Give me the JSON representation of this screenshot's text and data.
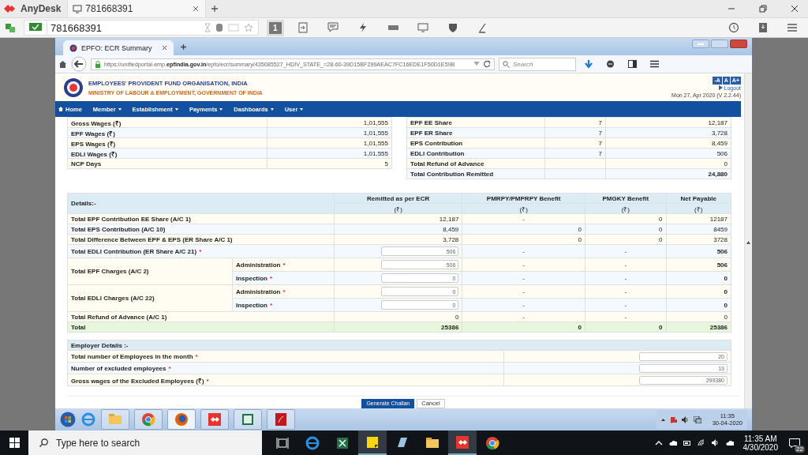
{
  "anydesk": {
    "app_name": "AnyDesk",
    "tab": "781668391",
    "address": "781668391",
    "display_number": "1"
  },
  "browser": {
    "tab_title": "EPFO: ECR Summary",
    "url_prefix": "https://unifiedportal-emp.",
    "url_domain": "epfindia.gov.in",
    "url_rest": "/epfo/ecr/summary/435085527_HDIV_STATE_=28-60-39D15BF299AEAC7FC16EDE1F50D1E59B",
    "search_placeholder": "Search"
  },
  "header": {
    "org": "EMPLOYEES' PROVIDENT FUND ORGANISATION, INDIA",
    "ministry": "MINISTRY OF LABOUR & EMPLOYMENT, GOVERNMENT OF INDIA",
    "font_buttons": [
      "-A",
      "A",
      "A+"
    ],
    "logout": "Logout",
    "date": "Mon 27, Apr 2020 (V 2.2.44)"
  },
  "nav": [
    {
      "label": "Home",
      "kind": "home"
    },
    {
      "label": "Member",
      "kind": "menu"
    },
    {
      "label": "Establishment",
      "kind": "menu"
    },
    {
      "label": "Payments",
      "kind": "menu"
    },
    {
      "label": "Dashboards",
      "kind": "menu"
    },
    {
      "label": "User",
      "kind": "menu"
    }
  ],
  "wages": [
    {
      "label": "Gross Wages (₹)",
      "value": "1,01,555"
    },
    {
      "label": "EPF Wages (₹)",
      "value": "1,01,555"
    },
    {
      "label": "EPS Wages (₹)",
      "value": "1,01,555"
    },
    {
      "label": "EDLI Wages (₹)",
      "value": "1,01,555"
    },
    {
      "label": "NCP Days",
      "value": "5"
    }
  ],
  "contributions": [
    {
      "label": "EPF EE Share",
      "rate": "7",
      "value": "12,187"
    },
    {
      "label": "EPF ER Share",
      "rate": "7",
      "value": "3,728"
    },
    {
      "label": "EPS Contribution",
      "rate": "7",
      "value": "8,459"
    },
    {
      "label": "EDLI Contribution",
      "rate": "7",
      "value": "506"
    },
    {
      "label": "Total Refund of Advance",
      "value": "0"
    },
    {
      "label": "Total Contribution Remitted",
      "value": "24,880",
      "bold": true
    }
  ],
  "details": {
    "title": "Details:-",
    "columns": [
      "Remitted as per ECR",
      "PMRPY/PMPRPY Benefit",
      "PMGKY Benefit",
      "Net Payable"
    ],
    "units": [
      "(₹)",
      "(₹)",
      "(₹)",
      "(₹)"
    ],
    "rows": [
      {
        "kind": "value",
        "label": "Total EPF Contribution EE Share (A/C 1)",
        "cells": [
          "12,187",
          "-",
          "0",
          "12187"
        ]
      },
      {
        "kind": "value",
        "label": "Total EPS Contribution (A/C 10)",
        "cells": [
          "8,459",
          "0",
          "0",
          "8459"
        ]
      },
      {
        "kind": "value",
        "label": "Total Difference Between EPF & EPS (ER Share A/C 1)",
        "cells": [
          "3,728",
          "0",
          "0",
          "3728"
        ]
      },
      {
        "kind": "input",
        "label": "Total EDLI Contribution (ER Share A/C 21)",
        "required_mark": "*",
        "cells": [
          "506",
          "-",
          "-",
          "506"
        ]
      },
      {
        "kind": "group",
        "label": "Total EPF Charges (A/C 2)",
        "children": [
          {
            "label": "Administration",
            "required_mark": "*",
            "cells": [
              "506",
              "-",
              "-",
              "506"
            ]
          },
          {
            "label": "Inspection",
            "required_mark": "*",
            "cells": [
              "0",
              "-",
              "-",
              "0"
            ]
          }
        ]
      },
      {
        "kind": "group",
        "label": "Total EDLI Charges (A/C 22)",
        "children": [
          {
            "label": "Administration",
            "required_mark": "*",
            "cells": [
              "0",
              "-",
              "-",
              "0"
            ]
          },
          {
            "label": "Inspection",
            "required_mark": "*",
            "cells": [
              "0",
              "-",
              "-",
              "0"
            ]
          }
        ]
      },
      {
        "kind": "value",
        "label": "Total Refund of Advance (A/C 1)",
        "cells": [
          "0",
          "-",
          "-",
          "0"
        ]
      },
      {
        "kind": "total",
        "label": "Total",
        "cells": [
          "25386",
          "0",
          "0",
          "25386"
        ]
      }
    ]
  },
  "employer": {
    "title": "Employer Details :-",
    "rows": [
      {
        "label": "Total number of Employees in the month",
        "required_mark": "*",
        "value": "20"
      },
      {
        "label": "Number of excluded employees",
        "required_mark": "*",
        "value": "13"
      },
      {
        "label": "Gross wages of the Excluded Employees (₹)",
        "required_mark": "*",
        "value": "299380"
      }
    ]
  },
  "buttons": [
    {
      "label": "Generate Challan",
      "kind": "primary"
    },
    {
      "label": "Cancel",
      "kind": "secondary"
    }
  ],
  "win7_tray": {
    "time": "11:35",
    "date": "30-04-2020"
  },
  "win10_taskbar": {
    "search_placeholder": "Type here to search",
    "time": "11:35 AM",
    "date": "4/30/2020",
    "notifications": "22"
  }
}
